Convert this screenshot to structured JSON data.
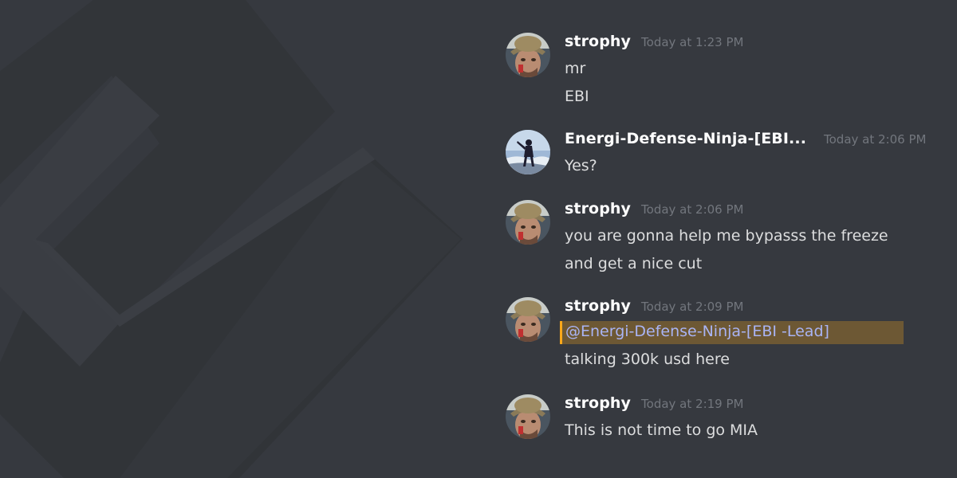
{
  "messages": [
    {
      "author": "strophy",
      "timestamp": "Today at 1:23 PM",
      "lines": [
        "mr",
        "EBI"
      ]
    },
    {
      "author": "Energi-Defense-Ninja-[EBI...",
      "timestamp": "Today at 2:06 PM",
      "lines": [
        "Yes?"
      ]
    },
    {
      "author": "strophy",
      "timestamp": "Today at 2:06 PM",
      "lines": [
        "you are gonna help me bypasss the freeze",
        "and get a nice cut"
      ]
    },
    {
      "author": "strophy",
      "timestamp": "Today at 2:09 PM",
      "mention": "@Energi-Defense-Ninja-[EBI -Lead]",
      "lines": [
        "talking 300k usd here"
      ]
    },
    {
      "author": "strophy",
      "timestamp": "Today at 2:19 PM",
      "lines": [
        "This is not time to go MIA"
      ]
    }
  ],
  "colors": {
    "background": "#36393f",
    "username": "#ffffff",
    "timestamp": "#72767d",
    "text": "#dcddde",
    "mention_text": "#a9b4f5",
    "mention_highlight": "#faa81a"
  }
}
